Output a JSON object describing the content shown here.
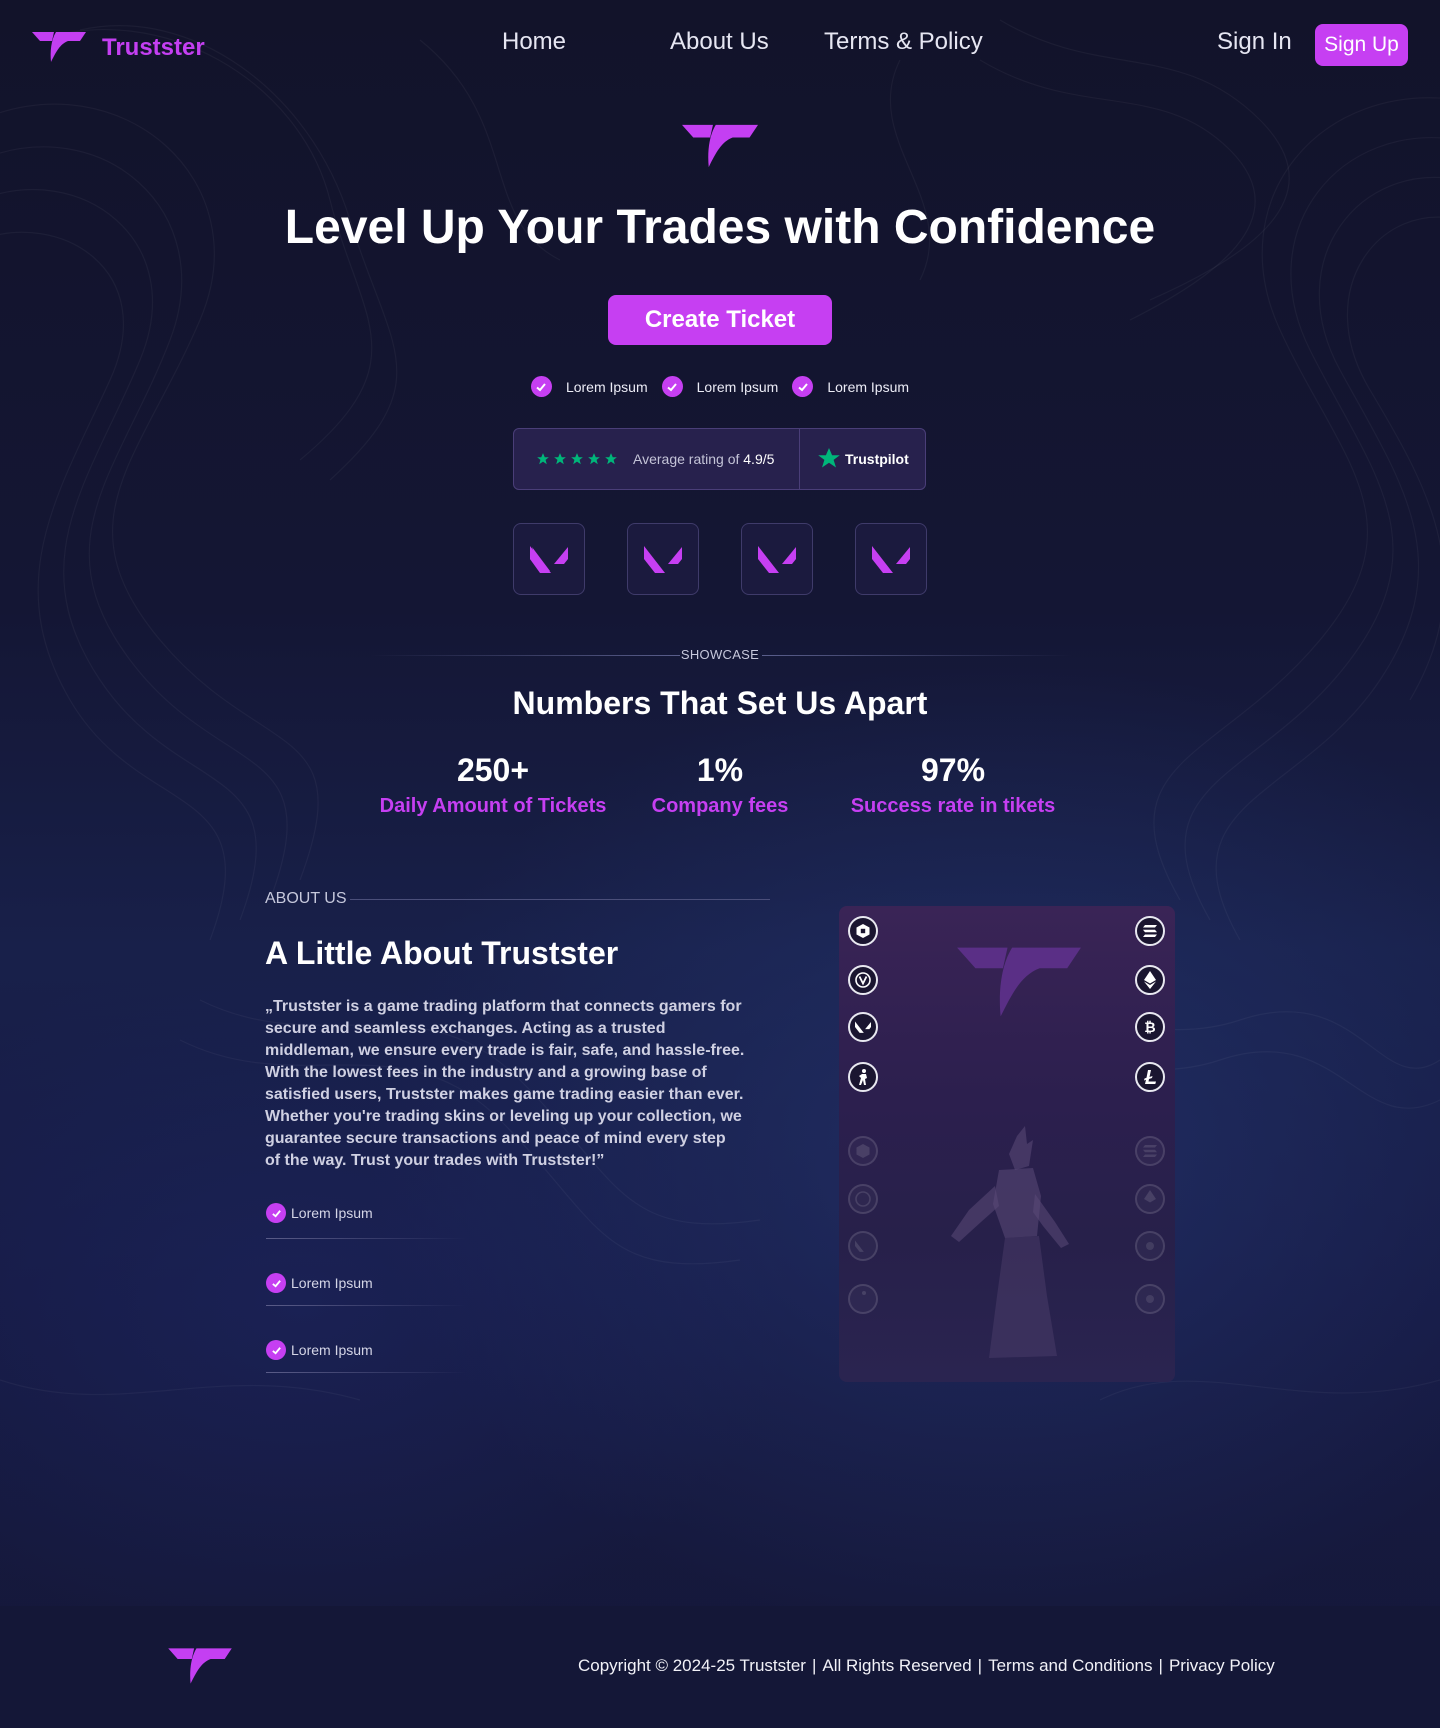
{
  "header": {
    "brand": "Trustster",
    "nav": [
      {
        "label": "Home"
      },
      {
        "label": "About Us"
      },
      {
        "label": "Terms & Policy"
      }
    ],
    "sign_in": "Sign In",
    "sign_up": "Sign Up"
  },
  "hero": {
    "title": "Level Up Your Trades with Confidence",
    "cta": "Create Ticket",
    "checks": [
      "Lorem Ipsum",
      "Lorem Ipsum",
      "Lorem Ipsum"
    ],
    "rating": {
      "prefix": "Average rating of ",
      "value": "4.9/5",
      "stars": 5,
      "provider": "Trustpilot"
    },
    "game_tiles": [
      "valorant-icon",
      "valorant-icon",
      "valorant-icon",
      "valorant-icon"
    ]
  },
  "showcase": {
    "label": "SHOWCASE",
    "title": "Numbers That Set Us Apart",
    "stats": [
      {
        "value": "250+",
        "label": "Daily Amount of Tickets"
      },
      {
        "value": "1%",
        "label": "Company fees"
      },
      {
        "value": "97%",
        "label": "Success rate in tikets"
      }
    ]
  },
  "about": {
    "label": "ABOUT US",
    "title": "A Little About Trustster",
    "text": "„Trustster is a game trading platform that connects gamers for secure and seamless exchanges. Acting as a trusted middleman, we ensure every trade is fair, safe, and hassle-free. With the lowest fees in the industry and a growing base of satisfied users, Trustster makes game trading easier than ever. Whether you're trading skins or leveling up your collection, we guarantee secure transactions and peace of mind every step of the way. Trust your trades with Trustster!”",
    "checks": [
      "Lorem Ipsum",
      "Lorem Ipsum",
      "Lorem Ipsum"
    ],
    "left_icons": [
      "roblox-icon",
      "fortnite-icon",
      "valorant-icon",
      "counter-strike-icon"
    ],
    "right_icons": [
      "solana-icon",
      "ethereum-icon",
      "bitcoin-icon",
      "litecoin-icon"
    ]
  },
  "footer": {
    "copyright": "Copyright © 2024-25 Trustster",
    "rights": "All Rights Reserved",
    "terms": "Terms and Conditions",
    "privacy": "Privacy Policy"
  },
  "colors": {
    "accent": "#c63ff2",
    "background": "#141634",
    "star": "#00b67a"
  }
}
